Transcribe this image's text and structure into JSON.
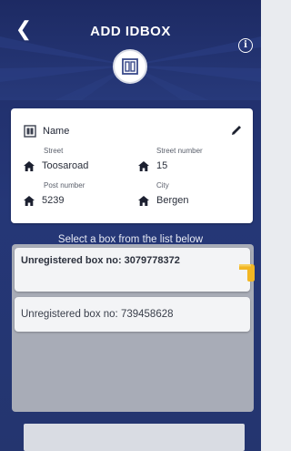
{
  "header": {
    "title": "ADD IDBOX"
  },
  "card": {
    "name_label": "Name",
    "fields": [
      {
        "caption": "Street",
        "value": "Toosaroad"
      },
      {
        "caption": "Street number",
        "value": "15"
      },
      {
        "caption": "Post number",
        "value": "5239"
      },
      {
        "caption": "City",
        "value": "Bergen"
      }
    ]
  },
  "section_label": "Select a box from the list below",
  "list": {
    "items": [
      {
        "label": "Unregistered box no: 3079778372"
      },
      {
        "label": "Unregistered box no: 739458628"
      }
    ]
  },
  "colors": {
    "header_bg": "#1f2b66",
    "accent": "#f2b623"
  }
}
